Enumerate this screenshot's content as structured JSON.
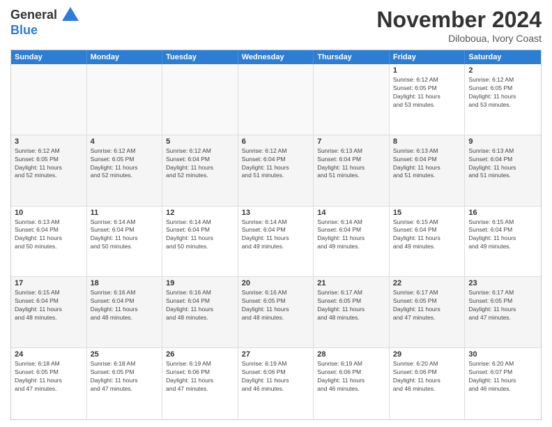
{
  "logo": {
    "line1": "General",
    "line2": "Blue"
  },
  "title": "November 2024",
  "location": "Diloboua, Ivory Coast",
  "header_days": [
    "Sunday",
    "Monday",
    "Tuesday",
    "Wednesday",
    "Thursday",
    "Friday",
    "Saturday"
  ],
  "weeks": [
    [
      {
        "day": "",
        "info": "",
        "empty": true
      },
      {
        "day": "",
        "info": "",
        "empty": true
      },
      {
        "day": "",
        "info": "",
        "empty": true
      },
      {
        "day": "",
        "info": "",
        "empty": true
      },
      {
        "day": "",
        "info": "",
        "empty": true
      },
      {
        "day": "1",
        "info": "Sunrise: 6:12 AM\nSunset: 6:05 PM\nDaylight: 11 hours\nand 53 minutes.",
        "empty": false
      },
      {
        "day": "2",
        "info": "Sunrise: 6:12 AM\nSunset: 6:05 PM\nDaylight: 11 hours\nand 53 minutes.",
        "empty": false
      }
    ],
    [
      {
        "day": "3",
        "info": "Sunrise: 6:12 AM\nSunset: 6:05 PM\nDaylight: 11 hours\nand 52 minutes.",
        "empty": false
      },
      {
        "day": "4",
        "info": "Sunrise: 6:12 AM\nSunset: 6:05 PM\nDaylight: 11 hours\nand 52 minutes.",
        "empty": false
      },
      {
        "day": "5",
        "info": "Sunrise: 6:12 AM\nSunset: 6:04 PM\nDaylight: 11 hours\nand 52 minutes.",
        "empty": false
      },
      {
        "day": "6",
        "info": "Sunrise: 6:12 AM\nSunset: 6:04 PM\nDaylight: 11 hours\nand 51 minutes.",
        "empty": false
      },
      {
        "day": "7",
        "info": "Sunrise: 6:13 AM\nSunset: 6:04 PM\nDaylight: 11 hours\nand 51 minutes.",
        "empty": false
      },
      {
        "day": "8",
        "info": "Sunrise: 6:13 AM\nSunset: 6:04 PM\nDaylight: 11 hours\nand 51 minutes.",
        "empty": false
      },
      {
        "day": "9",
        "info": "Sunrise: 6:13 AM\nSunset: 6:04 PM\nDaylight: 11 hours\nand 51 minutes.",
        "empty": false
      }
    ],
    [
      {
        "day": "10",
        "info": "Sunrise: 6:13 AM\nSunset: 6:04 PM\nDaylight: 11 hours\nand 50 minutes.",
        "empty": false
      },
      {
        "day": "11",
        "info": "Sunrise: 6:14 AM\nSunset: 6:04 PM\nDaylight: 11 hours\nand 50 minutes.",
        "empty": false
      },
      {
        "day": "12",
        "info": "Sunrise: 6:14 AM\nSunset: 6:04 PM\nDaylight: 11 hours\nand 50 minutes.",
        "empty": false
      },
      {
        "day": "13",
        "info": "Sunrise: 6:14 AM\nSunset: 6:04 PM\nDaylight: 11 hours\nand 49 minutes.",
        "empty": false
      },
      {
        "day": "14",
        "info": "Sunrise: 6:14 AM\nSunset: 6:04 PM\nDaylight: 11 hours\nand 49 minutes.",
        "empty": false
      },
      {
        "day": "15",
        "info": "Sunrise: 6:15 AM\nSunset: 6:04 PM\nDaylight: 11 hours\nand 49 minutes.",
        "empty": false
      },
      {
        "day": "16",
        "info": "Sunrise: 6:15 AM\nSunset: 6:04 PM\nDaylight: 11 hours\nand 49 minutes.",
        "empty": false
      }
    ],
    [
      {
        "day": "17",
        "info": "Sunrise: 6:15 AM\nSunset: 6:04 PM\nDaylight: 11 hours\nand 48 minutes.",
        "empty": false
      },
      {
        "day": "18",
        "info": "Sunrise: 6:16 AM\nSunset: 6:04 PM\nDaylight: 11 hours\nand 48 minutes.",
        "empty": false
      },
      {
        "day": "19",
        "info": "Sunrise: 6:16 AM\nSunset: 6:04 PM\nDaylight: 11 hours\nand 48 minutes.",
        "empty": false
      },
      {
        "day": "20",
        "info": "Sunrise: 6:16 AM\nSunset: 6:05 PM\nDaylight: 11 hours\nand 48 minutes.",
        "empty": false
      },
      {
        "day": "21",
        "info": "Sunrise: 6:17 AM\nSunset: 6:05 PM\nDaylight: 11 hours\nand 48 minutes.",
        "empty": false
      },
      {
        "day": "22",
        "info": "Sunrise: 6:17 AM\nSunset: 6:05 PM\nDaylight: 11 hours\nand 47 minutes.",
        "empty": false
      },
      {
        "day": "23",
        "info": "Sunrise: 6:17 AM\nSunset: 6:05 PM\nDaylight: 11 hours\nand 47 minutes.",
        "empty": false
      }
    ],
    [
      {
        "day": "24",
        "info": "Sunrise: 6:18 AM\nSunset: 6:05 PM\nDaylight: 11 hours\nand 47 minutes.",
        "empty": false
      },
      {
        "day": "25",
        "info": "Sunrise: 6:18 AM\nSunset: 6:05 PM\nDaylight: 11 hours\nand 47 minutes.",
        "empty": false
      },
      {
        "day": "26",
        "info": "Sunrise: 6:19 AM\nSunset: 6:06 PM\nDaylight: 11 hours\nand 47 minutes.",
        "empty": false
      },
      {
        "day": "27",
        "info": "Sunrise: 6:19 AM\nSunset: 6:06 PM\nDaylight: 11 hours\nand 46 minutes.",
        "empty": false
      },
      {
        "day": "28",
        "info": "Sunrise: 6:19 AM\nSunset: 6:06 PM\nDaylight: 11 hours\nand 46 minutes.",
        "empty": false
      },
      {
        "day": "29",
        "info": "Sunrise: 6:20 AM\nSunset: 6:06 PM\nDaylight: 11 hours\nand 46 minutes.",
        "empty": false
      },
      {
        "day": "30",
        "info": "Sunrise: 6:20 AM\nSunset: 6:07 PM\nDaylight: 11 hours\nand 46 minutes.",
        "empty": false
      }
    ]
  ]
}
